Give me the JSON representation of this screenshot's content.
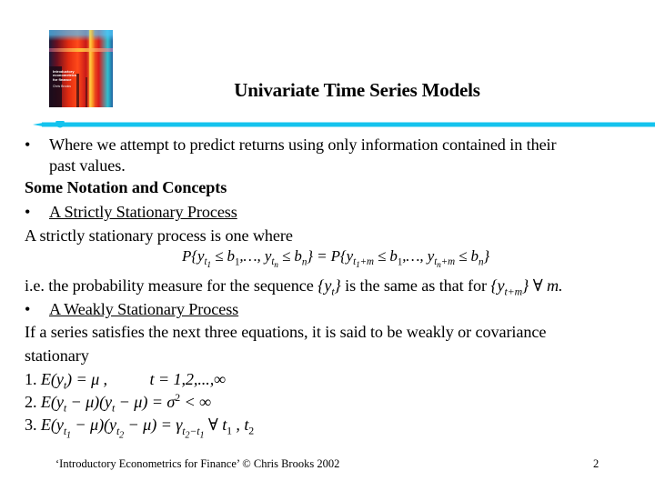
{
  "slide": {
    "title": "Univariate Time Series Models",
    "accent_color": "#14c3ee",
    "cover": {
      "title_lines": [
        "Introductory",
        "econometrics",
        "for finance"
      ],
      "author": "Chris Brooks"
    },
    "body": {
      "bullet1_line1": "Where we attempt to predict returns using only information contained in their",
      "bullet1_line2": "past values.",
      "heading": "Some Notation and Concepts",
      "bullet2": "A Strictly Stationary Process",
      "strict_def": "A strictly stationary process is one where",
      "ie_prefix": "i.e. the probability measure for the sequence ",
      "ie_middle": " is the same as that for ",
      "ie_suffix": " m.",
      "bullet3": "A Weakly Stationary Process",
      "weak_line1": "If a series satisfies the next three equations, it is said to be weakly or covariance",
      "weak_line2": "stationary",
      "eq1_label": "1.",
      "eq1_range": "t = 1,2,...,∞",
      "eq2_label": "2.",
      "eq3_label": "3.",
      "eq3_suffix": "∀ t",
      "bullet_glyph": "•"
    },
    "footer": {
      "citation": "‘Introductory Econometrics for Finance’ © Chris Brooks 2002",
      "page_number": "2"
    }
  }
}
